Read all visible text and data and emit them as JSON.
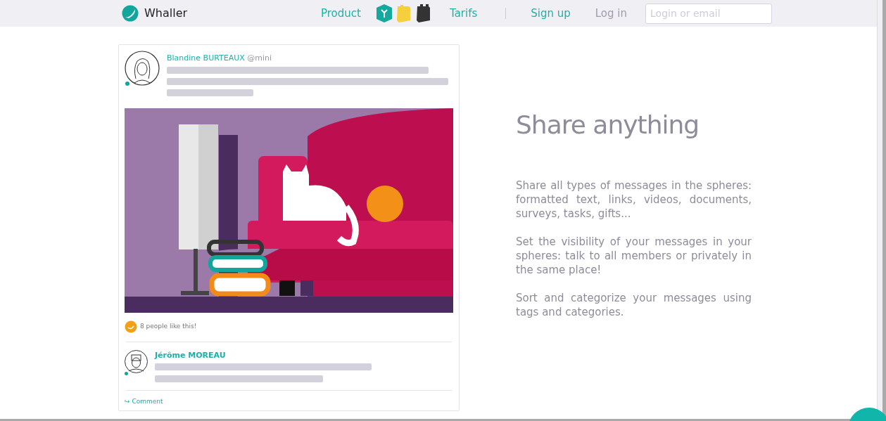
{
  "header": {
    "logo": "Whaller",
    "nav": [
      {
        "label": "Product",
        "kind": "link"
      },
      {
        "label": "Tarifs",
        "kind": "link"
      }
    ],
    "signup": "Sign up",
    "login": "Log in",
    "login_field": {
      "placeholder": "Login or email"
    }
  },
  "post": {
    "author": "Blandine BURTEAUX",
    "handle": "@mini",
    "online": true,
    "likes": "8 people like this!",
    "comment": {
      "author": "Jérôme MOREAU",
      "online": true
    },
    "comment_link": "↪ Comment"
  },
  "feature": {
    "title": "Share anything",
    "paragraphs": [
      "Share all types of messages in the spheres: formatted text, links, videos, documents, surveys, tasks, gifts...",
      "Set the visibility of your messages in your spheres: talk to all members or privately in the same place!",
      "Sort and categorize your messages using tags and categories."
    ]
  }
}
